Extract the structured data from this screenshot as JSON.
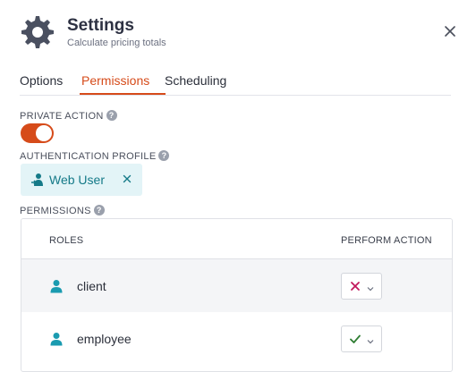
{
  "header": {
    "title": "Settings",
    "subtitle": "Calculate pricing totals"
  },
  "tabs": [
    {
      "label": "Options",
      "active": false
    },
    {
      "label": "Permissions",
      "active": true
    },
    {
      "label": "Scheduling",
      "active": false
    }
  ],
  "private_action": {
    "label": "PRIVATE ACTION",
    "help": "?",
    "enabled": true
  },
  "authentication_profile": {
    "label": "AUTHENTICATION PROFILE",
    "help": "?",
    "value": "Web User"
  },
  "permissions": {
    "label": "PERMISSIONS",
    "help": "?",
    "columns": {
      "roles": "ROLES",
      "perform_action": "PERFORM ACTION"
    },
    "rows": [
      {
        "role": "client",
        "allowed": false,
        "icon": "x-icon"
      },
      {
        "role": "employee",
        "allowed": true,
        "icon": "check-icon"
      }
    ]
  },
  "colors": {
    "accent": "#d64b1a",
    "teal": "#157a88",
    "chip_bg": "#e3f4f7",
    "deny": "#c2185b",
    "allow": "#2e7d32"
  }
}
